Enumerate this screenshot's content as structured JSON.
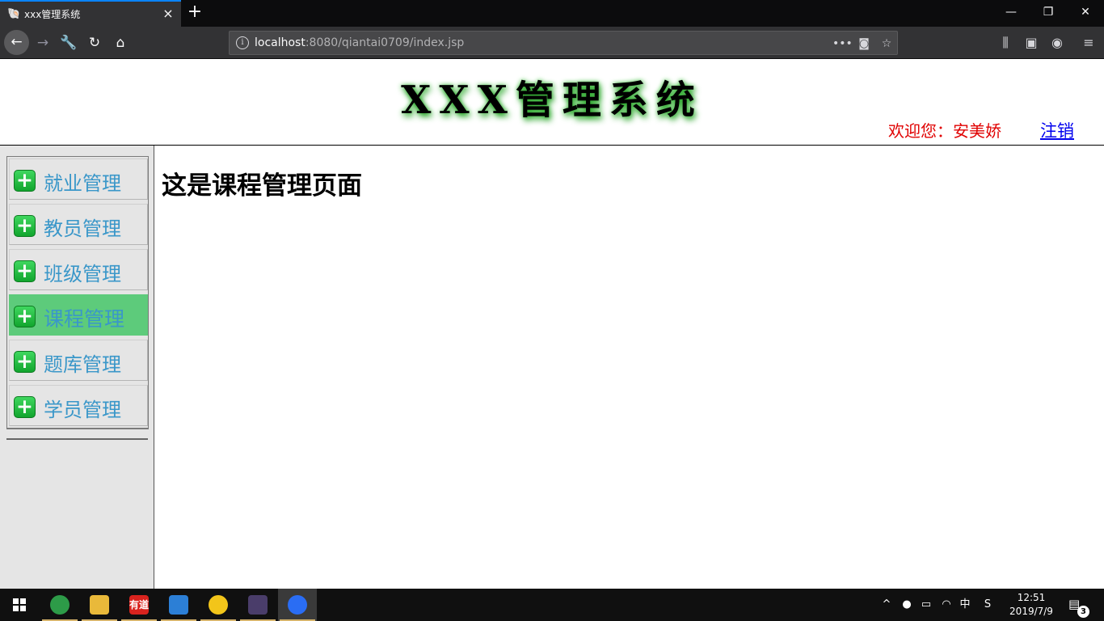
{
  "browser": {
    "tab_title": "xxx管理系统",
    "url_host": "localhost",
    "url_rest": ":8080/qiantai0709/index.jsp",
    "tab_close": "×",
    "new_tab": "+",
    "window_controls": {
      "minimize": "—",
      "maximize": "❐",
      "close": "✕"
    }
  },
  "header": {
    "title": "XXX管理系统",
    "welcome": "欢迎您：安美娇",
    "logout": "注销"
  },
  "sidebar": {
    "items": [
      {
        "label": "就业管理",
        "icon": "plus-icon",
        "active": false
      },
      {
        "label": "教员管理",
        "icon": "plus-icon",
        "active": false
      },
      {
        "label": "班级管理",
        "icon": "plus-icon",
        "active": false
      },
      {
        "label": "课程管理",
        "icon": "plus-icon",
        "active": true
      },
      {
        "label": "题库管理",
        "icon": "plus-icon",
        "active": false
      },
      {
        "label": "学员管理",
        "icon": "plus-icon",
        "active": false
      }
    ]
  },
  "content": {
    "heading": "这是课程管理页面"
  },
  "taskbar": {
    "apps": [
      {
        "name": "chrome",
        "label": "",
        "color": "#2d9b48"
      },
      {
        "name": "file-explorer",
        "label": "",
        "color": "#e9b93a"
      },
      {
        "name": "youdao",
        "label": "有道",
        "color": "#d9231e"
      },
      {
        "name": "app-dolphin",
        "label": "",
        "color": "#2c7fd6"
      },
      {
        "name": "app-yellow-circle",
        "label": "",
        "color": "#f2c51a"
      },
      {
        "name": "app-game",
        "label": "",
        "color": "#4a3d6a"
      },
      {
        "name": "firefox",
        "label": "",
        "color": "#2a6df4"
      }
    ],
    "ime": "中",
    "time": "12:51",
    "date": "2019/7/9",
    "notification_count": "3"
  },
  "colors": {
    "active_menu": "#5dcb7b",
    "menu_text": "#3a97c9",
    "welcome_text": "#e00000",
    "logout_link": "#0000ee",
    "title_glow": "#1e9e1e"
  }
}
